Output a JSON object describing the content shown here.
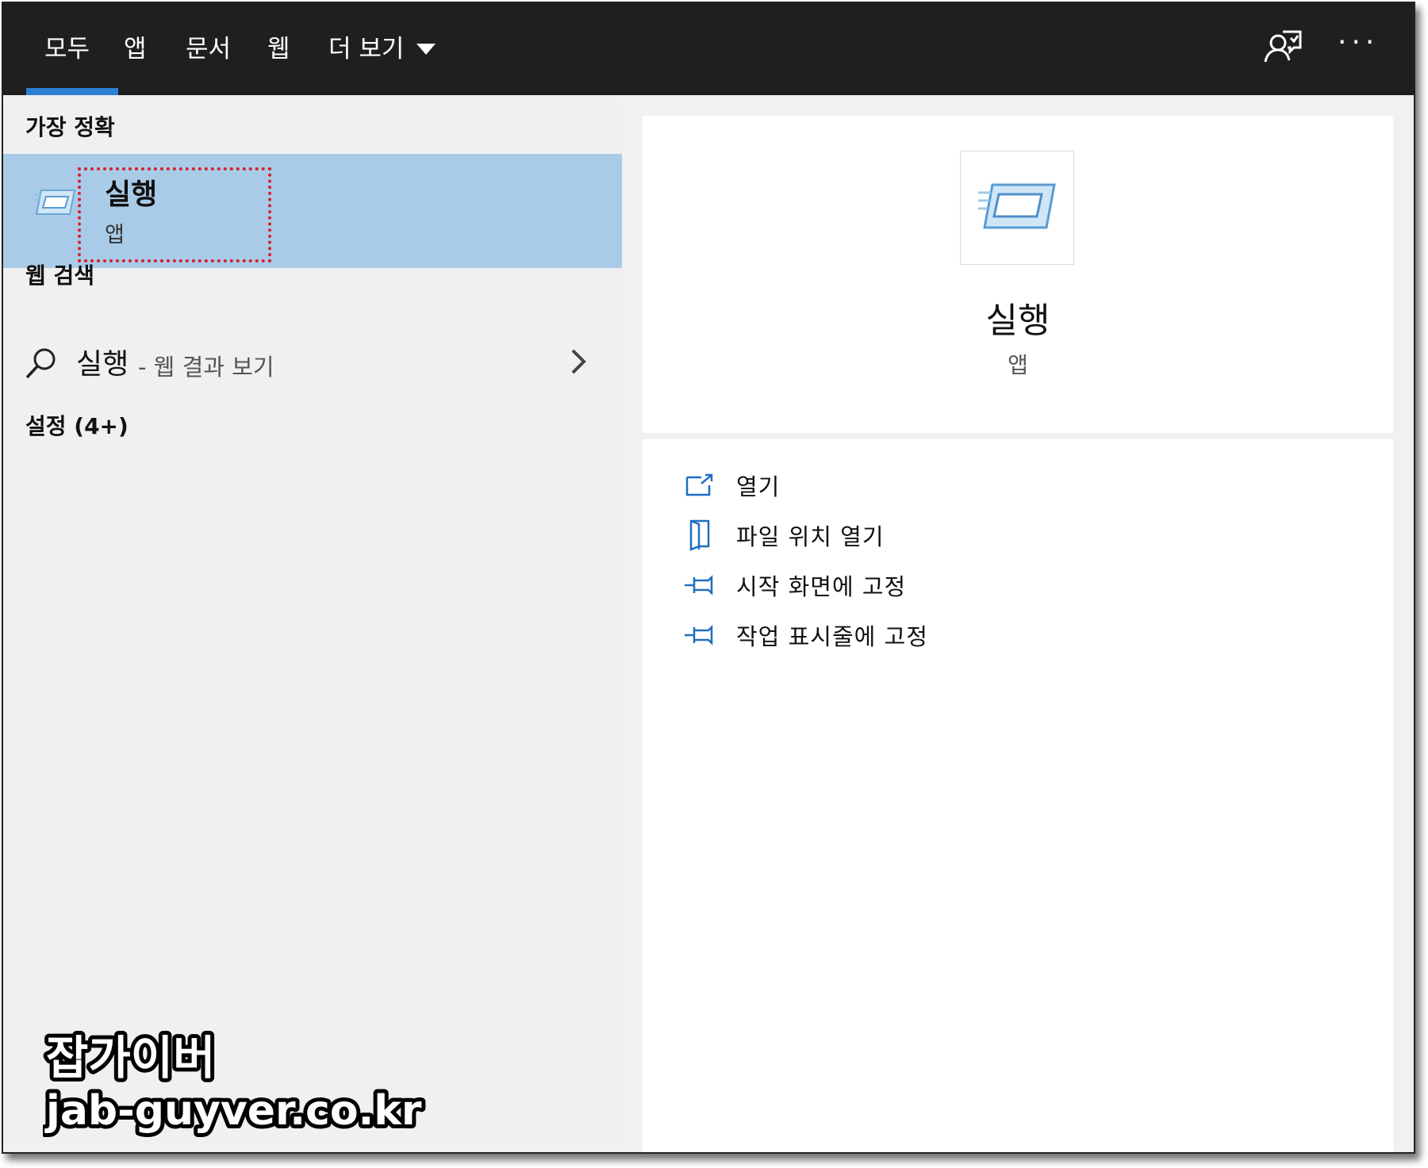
{
  "tabs": [
    {
      "label": "모두",
      "active": true
    },
    {
      "label": "앱",
      "active": false
    },
    {
      "label": "문서",
      "active": false
    },
    {
      "label": "웹",
      "active": false
    },
    {
      "label": "더 보기",
      "active": false
    }
  ],
  "toolbar": {
    "feedback_icon": "feedback-person-icon",
    "more_label": "···"
  },
  "left": {
    "best_match_heading": "가장 정확",
    "best_match": {
      "title": "실행",
      "subtitle": "앱",
      "icon": "run-dialog-icon"
    },
    "web_search_heading": "웹 검색",
    "web_search": {
      "query": "실행",
      "suffix": "- 웹 결과 보기"
    },
    "settings_heading": "설정 (4+)"
  },
  "right": {
    "app_name": "실행",
    "app_type": "앱",
    "actions": [
      {
        "label": "열기",
        "icon": "open-icon"
      },
      {
        "label": "파일 위치 열기",
        "icon": "file-location-icon"
      },
      {
        "label": "시작 화면에 고정",
        "icon": "pin-icon"
      },
      {
        "label": "작업 표시줄에 고정",
        "icon": "pin-icon"
      }
    ]
  },
  "watermark": {
    "line1": "잡가이버",
    "line2": "jab-guyver.co.kr"
  },
  "colors": {
    "accent": "#2d7fd3",
    "selection": "#a9cbe8",
    "topbar": "#1f1f1f",
    "highlight": "#d4202a"
  }
}
